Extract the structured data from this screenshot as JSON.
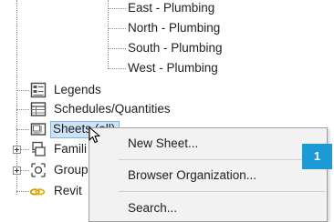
{
  "tree": {
    "plumbing_views": [
      "East - Plumbing",
      "North - Plumbing",
      "South - Plumbing",
      "West - Plumbing"
    ],
    "legends_label": "Legends",
    "schedules_label": "Schedules/Quantities",
    "sheets_label": "Sheets (all)",
    "families_label": "Famili",
    "groups_label": "Group",
    "revit_links_label": "Revit"
  },
  "context_menu": {
    "items": [
      "New Sheet...",
      "Browser Organization...",
      "Search..."
    ]
  },
  "callout_badge": "1",
  "icons": [
    "legend-icon",
    "schedule-icon",
    "sheet-icon",
    "family-icon",
    "group-icon",
    "link-icon",
    "expand-icon",
    "mouse-cursor-icon"
  ],
  "colors": {
    "selection_fill": "#cfe3f7",
    "selection_border": "#7eb4ea",
    "badge": "#1b9ad6"
  }
}
